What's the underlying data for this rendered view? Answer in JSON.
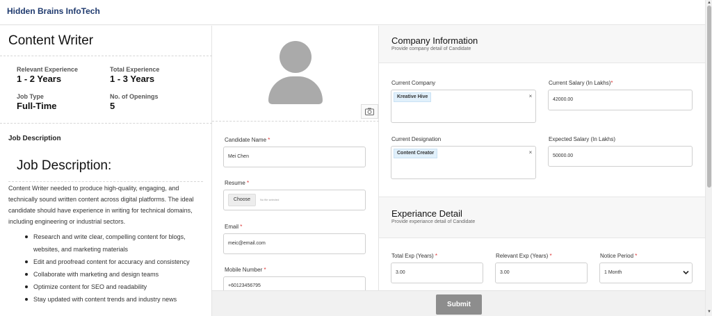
{
  "brand": "Hidden Brains InfoTech",
  "job": {
    "title": "Content Writer",
    "relevant_experience_label": "Relevant Experience",
    "relevant_experience": "1 - 2 Years",
    "total_experience_label": "Total Experience",
    "total_experience": "1 - 3 Years",
    "job_type_label": "Job Type",
    "job_type": "Full-Time",
    "openings_label": "No. of Openings",
    "openings": "5",
    "description_label": "Job Description",
    "description_heading": "Job Description:",
    "description_text": "Content Writer needed to produce high-quality, engaging, and technically sound written content across digital platforms. The ideal candidate should have experience in writing for technical domains, including engineering or industrial sectors.",
    "responsibilities": [
      "Research and write clear, compelling content for blogs, websites, and marketing materials",
      "Edit and proofread content for accuracy and consistency",
      "Collaborate with marketing and design teams",
      "Optimize content for SEO and readability",
      "Stay updated with content trends and industry news"
    ]
  },
  "candidate": {
    "name_label": "Candidate Name",
    "name_value": "Mei Chen",
    "resume_label": "Resume",
    "choose_label": "Choose",
    "no_file_text": "No file selected",
    "email_label": "Email",
    "email_value": "meic@email.com",
    "mobile_label": "Mobile Number",
    "mobile_value": "+60123456795",
    "required_mark": "*"
  },
  "company": {
    "title": "Company Information",
    "subtitle": "Provide company detail of Candidate",
    "current_company_label": "Current Company",
    "current_company_tag": "Kreative Hive",
    "current_salary_label": "Current Salary (In Lakhs)",
    "current_salary_value": "42000.00",
    "current_designation_label": "Current Designation",
    "current_designation_tag": "Content Creator",
    "expected_salary_label": "Expected Salary (In Lakhs)",
    "expected_salary_value": "50000.00",
    "remove_mark": "×"
  },
  "experience": {
    "title": "Experiance Detail",
    "subtitle": "Provide experiance detail of Candidate",
    "total_exp_label": "Total Exp (Years)",
    "total_exp_value": "3.00",
    "relevant_exp_label": "Relevant Exp (Years)",
    "relevant_exp_value": "3.00",
    "notice_label": "Notice Period",
    "notice_value": "1 Month"
  },
  "submit_label": "Submit",
  "colors": {
    "brand": "#1f3a6e",
    "tag_bg": "#e1f0fb",
    "submit_bg": "#8d8d8d",
    "required": "#d33333"
  }
}
